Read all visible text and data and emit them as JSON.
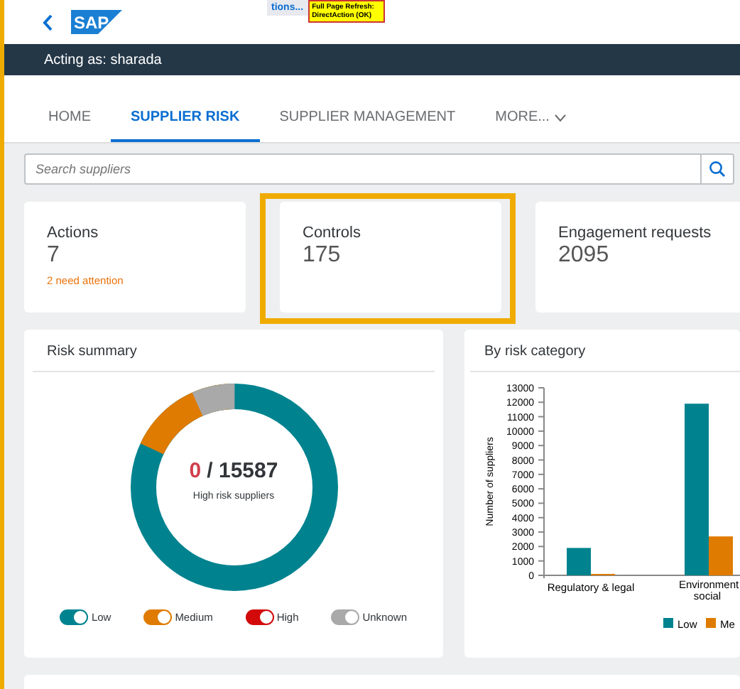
{
  "header": {
    "logo": "SAP",
    "tab_fragment": "tions...",
    "debug_tag": "Full Page Refresh: DirectAction (OK)"
  },
  "user_bar": {
    "text": "Acting as: sharada"
  },
  "nav_tabs": [
    {
      "label": "HOME",
      "selected": false
    },
    {
      "label": "SUPPLIER RISK",
      "selected": true
    },
    {
      "label": "SUPPLIER MANAGEMENT",
      "selected": false
    },
    {
      "label": "MORE...",
      "selected": false
    }
  ],
  "search": {
    "placeholder": "Search suppliers"
  },
  "tiles": [
    {
      "title": "Actions",
      "value": "7",
      "note": "2 need attention",
      "highlighted": false
    },
    {
      "title": "Controls",
      "value": "175",
      "highlighted": true
    },
    {
      "title": "Engagement requests",
      "value": "2095",
      "highlighted": false
    }
  ],
  "risk_summary": {
    "title": "Risk summary",
    "high": "0",
    "total": "/ 15587",
    "caption": "High risk suppliers",
    "legend": [
      {
        "label": "Low",
        "color": "#00838f",
        "on": true
      },
      {
        "label": "Medium",
        "color": "#df7b00",
        "on": true
      },
      {
        "label": "High",
        "color": "#d20a0a",
        "on": true
      },
      {
        "label": "Unknown",
        "color": "#a9a9a9",
        "on": true
      }
    ]
  },
  "risk_category": {
    "title": "By risk category",
    "chart_data": {
      "type": "bar",
      "ylabel": "Number of suppliers",
      "categories": [
        "Regulatory & legal",
        "Environment social"
      ],
      "series": [
        {
          "name": "Low",
          "color": "#00838f",
          "values": [
            1900,
            11900
          ]
        },
        {
          "name": "Me",
          "color": "#df7b00",
          "values": [
            100,
            2700
          ]
        }
      ],
      "legend": "bottom",
      "ylim": [
        0,
        13000
      ],
      "yticks": [
        0,
        1000,
        2000,
        3000,
        4000,
        5000,
        6000,
        7000,
        8000,
        9000,
        10000,
        11000,
        12000,
        13000
      ]
    }
  }
}
